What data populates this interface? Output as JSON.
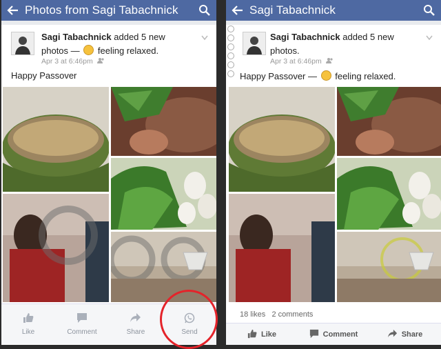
{
  "left": {
    "topbar": {
      "title": "Photos from Sagi Tabachnick"
    },
    "post": {
      "author": "Sagi Tabachnick",
      "action": "added 5 new",
      "action_line2": "photos — ",
      "feeling": "feeling relaxed.",
      "timestamp": "Apr 3 at 6:46pm",
      "caption": "Happy Passover"
    },
    "actions": [
      {
        "label": "Like",
        "icon": "like-icon"
      },
      {
        "label": "Comment",
        "icon": "comment-icon"
      },
      {
        "label": "Share",
        "icon": "share-icon"
      },
      {
        "label": "Send",
        "icon": "whatsapp-icon"
      }
    ]
  },
  "right": {
    "topbar": {
      "title": "Sagi Tabachnick"
    },
    "post": {
      "author": "Sagi Tabachnick",
      "action": "added 5 new",
      "action_line2": "photos.",
      "timestamp": "Apr 3 at 6:46pm",
      "caption": "Happy Passover — ",
      "feeling": "feeling relaxed."
    },
    "stats": {
      "likes": "18 likes",
      "comments": "2 comments"
    },
    "actions": [
      {
        "label": "Like",
        "icon": "like-icon"
      },
      {
        "label": "Comment",
        "icon": "comment-icon"
      },
      {
        "label": "Share",
        "icon": "share-icon"
      }
    ]
  },
  "colors": {
    "topbar": "#4e69a2",
    "highlight_ring": "#e4232a"
  }
}
